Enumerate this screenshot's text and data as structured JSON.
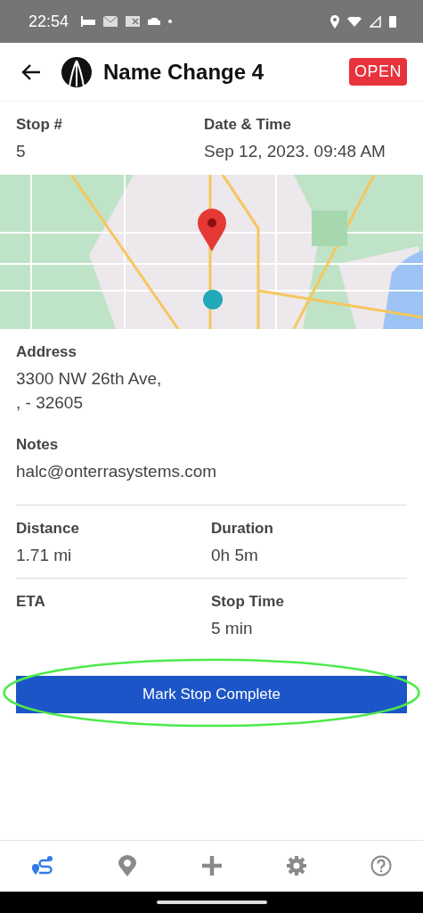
{
  "status_bar": {
    "time": "22:54"
  },
  "header": {
    "title": "Name Change 4",
    "badge": "OPEN"
  },
  "stop": [
    {
      "label": "Stop #",
      "value": "5"
    },
    {
      "label": "Date & Time",
      "value": "Sep 12, 2023. 09:48 AM"
    }
  ],
  "address": {
    "label": "Address",
    "lines": [
      "3300 NW 26th Ave,",
      ",  - 32605"
    ]
  },
  "notes": {
    "label": "Notes",
    "value": "halc@onterrasystems.com"
  },
  "metrics": [
    {
      "label": "Distance",
      "value": "1.71 mi"
    },
    {
      "label": "Duration",
      "value": "0h 5m"
    }
  ],
  "timing": [
    {
      "label": "ETA"
    },
    {
      "label": "Stop Time",
      "value": "5 min"
    }
  ],
  "action": {
    "label": "Mark Stop Complete"
  },
  "bottom_nav": [
    {
      "kind": "route",
      "selected": true
    },
    {
      "kind": "pin",
      "selected": false
    },
    {
      "kind": "add",
      "selected": false
    },
    {
      "kind": "settings",
      "selected": false
    },
    {
      "kind": "help",
      "selected": false
    }
  ]
}
